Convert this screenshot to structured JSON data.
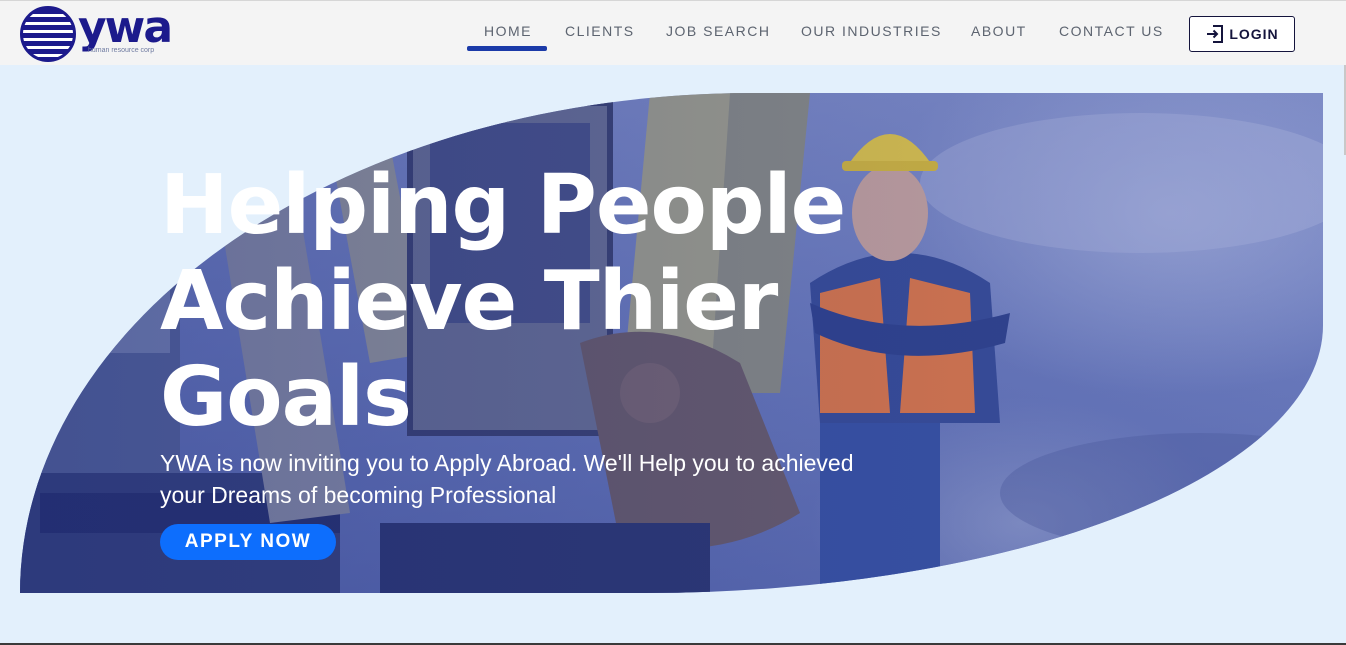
{
  "brand": {
    "logo_word": "ywa",
    "tagline": "human resource corp"
  },
  "nav": {
    "items": [
      {
        "label": "HOME",
        "active": true
      },
      {
        "label": "CLIENTS"
      },
      {
        "label": "JOB SEARCH"
      },
      {
        "label": "OUR INDUSTRIES"
      },
      {
        "label": "ABOUT"
      },
      {
        "label": "CONTACT US"
      }
    ],
    "login_label": "LOGIN"
  },
  "hero": {
    "title_line1": "Helping People",
    "title_line2": "Achieve Thier",
    "title_line3": "Goals",
    "subtitle_line1": "YWA is now inviting you to Apply Abroad. We'll Help you to achieved",
    "subtitle_line2": "your Dreams of becoming Professional",
    "cta_label": "APPLY NOW"
  },
  "colors": {
    "brand": "#1c1a8c",
    "accent": "#0d6efd",
    "nav_active": "#1b3aa8",
    "page_bg": "#e3f0fc"
  }
}
